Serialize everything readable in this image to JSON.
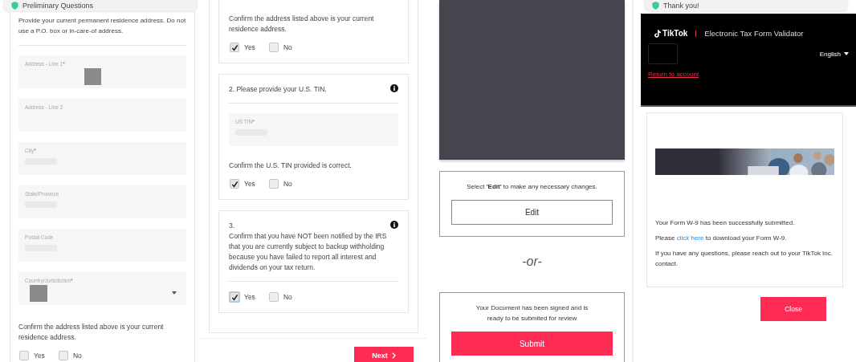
{
  "address_screen": {
    "tab_title": "Preliminary Questions",
    "instructions": "Provide your current permanent residence address. Do not use a P.O. box or in-care-of address.",
    "fields": [
      {
        "label": "Address - Line 1",
        "required_mark": "*",
        "masked": true,
        "kind": "text"
      },
      {
        "label": "Address - Line 2",
        "kind": "text"
      },
      {
        "label": "City",
        "required_mark": "*",
        "blurred": true,
        "kind": "text"
      },
      {
        "label": "State/Province",
        "blurred": true,
        "kind": "text"
      },
      {
        "label": "Postal Code",
        "blurred": true,
        "kind": "text"
      },
      {
        "label": "Country/Jurisdiction",
        "required_mark": "*",
        "masked": true,
        "kind": "select"
      }
    ],
    "confirm": {
      "question": "Confirm the address listed above is your current residence address.",
      "options": [
        {
          "label": "Yes",
          "checked": false,
          "focused": false
        },
        {
          "label": "No",
          "checked": false,
          "focused": false
        }
      ]
    }
  },
  "questions_screen": {
    "cards": [
      {
        "kind": "confirm",
        "question": "Confirm the address listed above is your current residence address.",
        "options": [
          {
            "label": "Yes",
            "checked": true,
            "focused": false
          },
          {
            "label": "No",
            "checked": false,
            "focused": false
          }
        ]
      },
      {
        "kind": "tin",
        "heading": "2. Please provide your U.S. TIN.",
        "info": true,
        "field": {
          "label": "US TIN",
          "required_mark": "*",
          "blurred": true
        },
        "question": "Confirm the U.S. TIN provided is correct.",
        "options": [
          {
            "label": "Yes",
            "checked": true,
            "focused": false
          },
          {
            "label": "No",
            "checked": false,
            "focused": false
          }
        ]
      },
      {
        "kind": "statement",
        "heading": "3.",
        "info": true,
        "question": "Confirm that you have NOT been notified by the IRS that you are currently subject to backup withholding because you have failed to report all interest and dividends on your tax return.",
        "options": [
          {
            "label": "Yes",
            "checked": true,
            "focused": true
          },
          {
            "label": "No",
            "checked": false,
            "focused": false
          }
        ]
      }
    ],
    "next_button": "Next"
  },
  "review_screen": {
    "edit_prompt": "Select **'Edit'** to make any necessary changes.",
    "edit_button": "Edit",
    "separator": "-or-",
    "submit_prompt": "Your Document has been signed and is ready to be submited for review",
    "submit_button": "Submit"
  },
  "confirmation_screen": {
    "tab_title": "Thank you!",
    "brand": "TikTok",
    "app_title": "Electronic Tax Form Validator",
    "language": "English",
    "return_link": "Return to account",
    "messages": [
      {
        "kind": "text",
        "text": "Your Form W-9 has been successfully submitted."
      },
      {
        "kind": "link",
        "before": "Please",
        "link": "click here",
        "after": "to download your Form W-9."
      },
      {
        "kind": "text",
        "text": "If you have any questions, please reach out to your TikTok Inc. contact."
      }
    ],
    "close_button": "Close"
  }
}
